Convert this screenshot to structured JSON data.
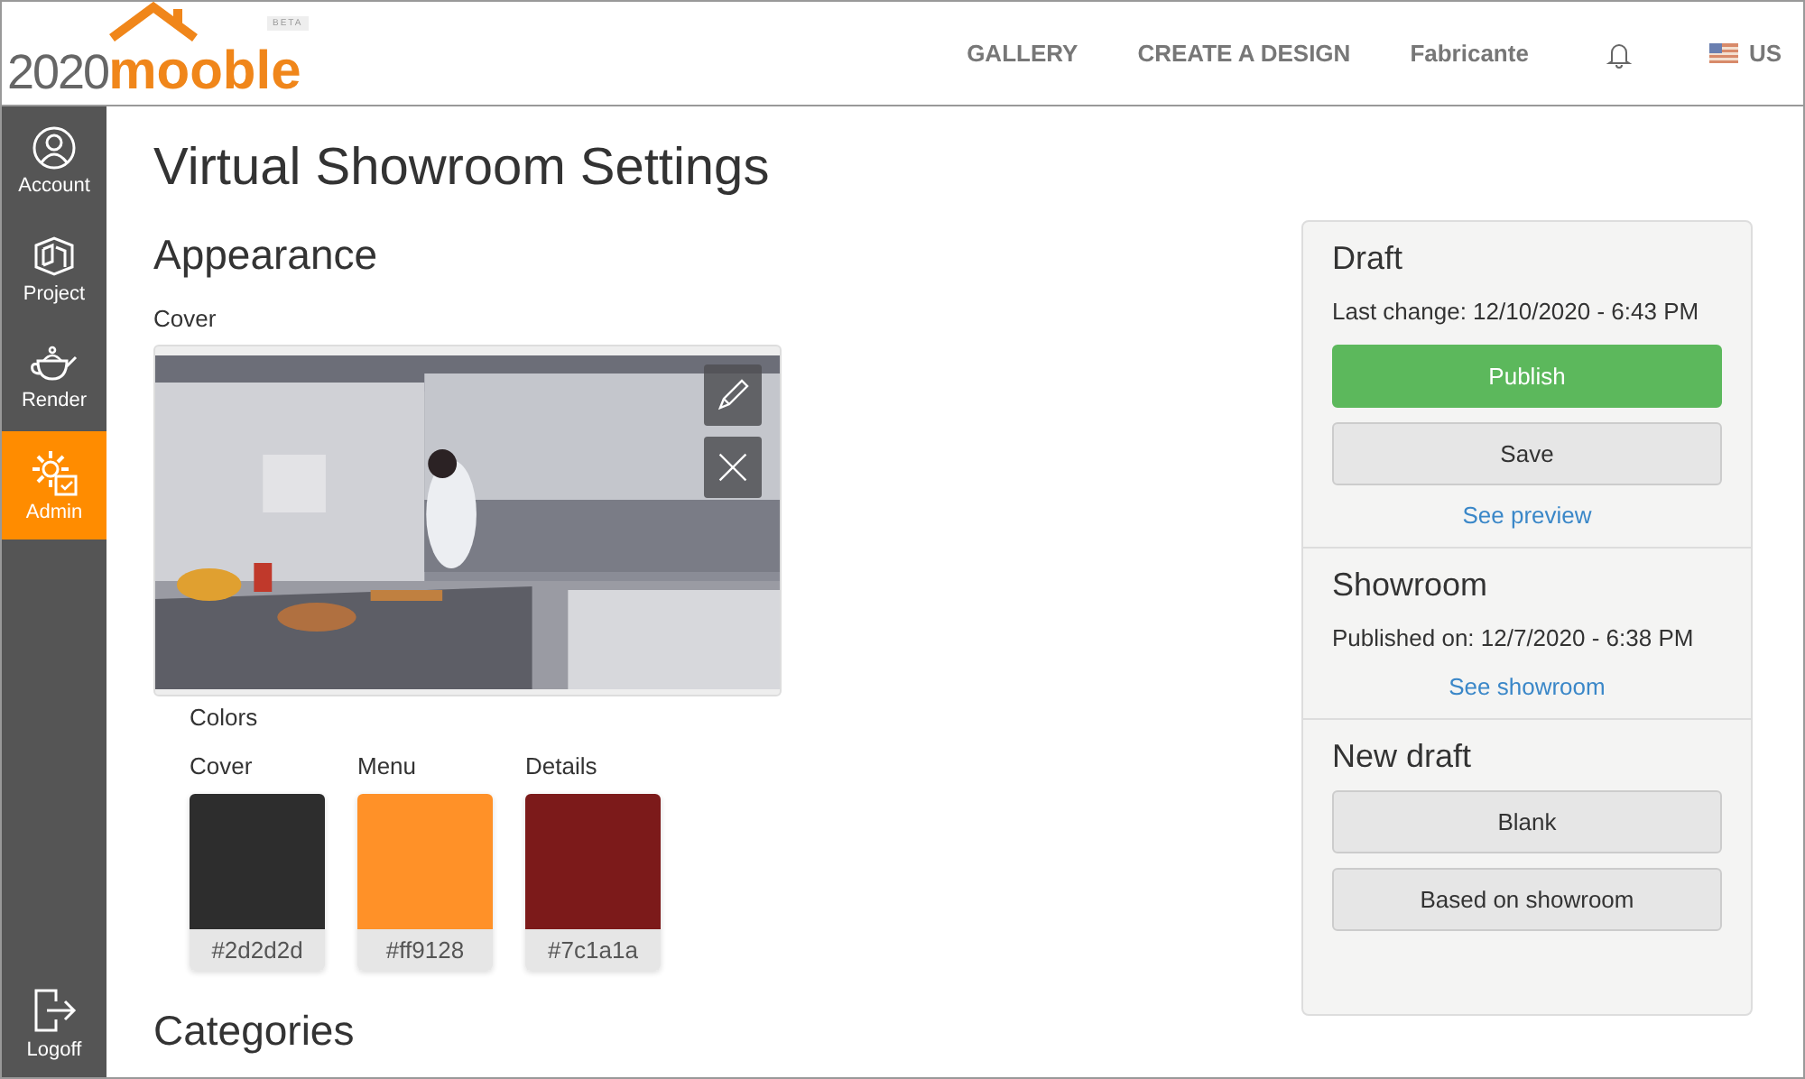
{
  "header": {
    "logo": {
      "digits": "2020",
      "word": "mooble",
      "badge": "BETA"
    },
    "nav": [
      {
        "label": "GALLERY"
      },
      {
        "label": "CREATE A DESIGN"
      },
      {
        "label": "Fabricante"
      }
    ],
    "language": "US"
  },
  "sidebar": {
    "items": [
      {
        "label": "Account",
        "kind": "account",
        "selected": false
      },
      {
        "label": "Project",
        "kind": "project",
        "selected": false
      },
      {
        "label": "Render",
        "kind": "render",
        "selected": false
      },
      {
        "label": "Admin",
        "kind": "admin",
        "selected": true
      }
    ],
    "footer": {
      "label": "Logoff"
    }
  },
  "title": "Virtual Showroom Settings",
  "appearance": {
    "heading": "Appearance",
    "cover_label": "Cover",
    "colors_label": "Colors",
    "colors": [
      {
        "label": "Cover",
        "color": "#2d2d2d",
        "hex": "#2d2d2d"
      },
      {
        "label": "Menu",
        "color": "#ff9128",
        "hex": "#ff9128"
      },
      {
        "label": "Details",
        "color": "#7c1a1a",
        "hex": "#7c1a1a"
      }
    ]
  },
  "categories_heading": "Categories",
  "panel": {
    "sections": [
      {
        "title": "Draft",
        "info": "Last change: 12/10/2020 - 6:43 PM",
        "buttons": [
          {
            "label": "Publish",
            "kind": "primary"
          },
          {
            "label": "Save",
            "kind": "default"
          }
        ],
        "link": "See preview"
      },
      {
        "title": "Showroom",
        "info": "Published on: 12/7/2020 - 6:38 PM",
        "link": "See showroom"
      },
      {
        "title": "New draft",
        "buttons": [
          {
            "label": "Blank",
            "kind": "default"
          },
          {
            "label": "Based on showroom",
            "kind": "default"
          }
        ]
      }
    ]
  }
}
